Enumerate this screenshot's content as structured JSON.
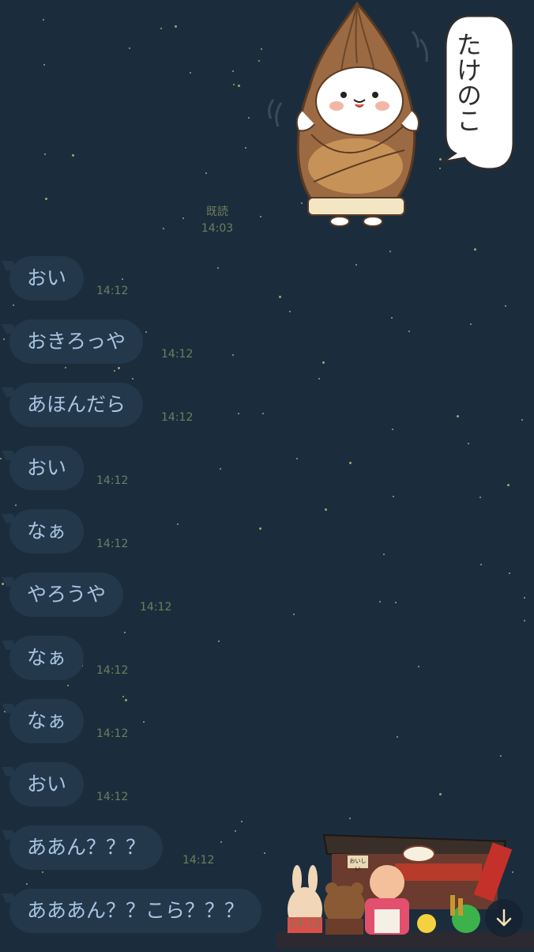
{
  "read_receipt": {
    "label": "既読",
    "time": "14:03"
  },
  "sticker": {
    "name": "bamboo-shoot-seal-sticker",
    "speech_text": "たけのこ"
  },
  "messages": [
    {
      "text": "おい",
      "time": "14:12"
    },
    {
      "text": "おきろっや",
      "time": "14:12"
    },
    {
      "text": "あほんだら",
      "time": "14:12"
    },
    {
      "text": "おい",
      "time": "14:12"
    },
    {
      "text": "なぁ",
      "time": "14:12"
    },
    {
      "text": "やろうや",
      "time": "14:12"
    },
    {
      "text": "なぁ",
      "time": "14:12"
    },
    {
      "text": "なぁ",
      "time": "14:12"
    },
    {
      "text": "おい",
      "time": "14:12"
    },
    {
      "text": "ああん？？？",
      "time": "14:12"
    },
    {
      "text": "あああん？？こら？？？",
      "time": "14:12"
    }
  ],
  "background_scene": {
    "name": "food-stall-characters",
    "sign_text": "おいしい"
  },
  "scroll_button": {
    "icon": "arrow-down-icon"
  },
  "colors": {
    "background": "#1b2d3d",
    "bubble": "#23384b",
    "bubble_text": "#a8c4e0",
    "meta_text": "#6f7e5a"
  }
}
